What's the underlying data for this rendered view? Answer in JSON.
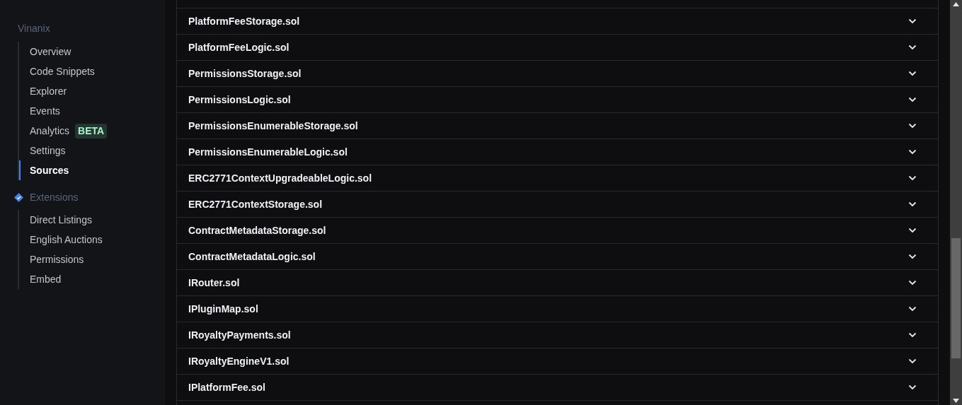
{
  "sidebar": {
    "title": "Vinanix",
    "items": [
      {
        "label": "Overview",
        "selected": false
      },
      {
        "label": "Code Snippets",
        "selected": false
      },
      {
        "label": "Explorer",
        "selected": false
      },
      {
        "label": "Events",
        "selected": false
      },
      {
        "label": "Analytics",
        "selected": false,
        "badge": "BETA"
      },
      {
        "label": "Settings",
        "selected": false
      },
      {
        "label": "Sources",
        "selected": true
      }
    ],
    "extensions": {
      "title": "Extensions",
      "items": [
        {
          "label": "Direct Listings",
          "selected": false
        },
        {
          "label": "English Auctions",
          "selected": false
        },
        {
          "label": "Permissions",
          "selected": false
        },
        {
          "label": "Embed",
          "selected": false
        }
      ]
    }
  },
  "sources": [
    {
      "name": "PlatformFeeStorage.sol",
      "expanded": false
    },
    {
      "name": "PlatformFeeLogic.sol",
      "expanded": false
    },
    {
      "name": "PermissionsStorage.sol",
      "expanded": false
    },
    {
      "name": "PermissionsLogic.sol",
      "expanded": false
    },
    {
      "name": "PermissionsEnumerableStorage.sol",
      "expanded": false
    },
    {
      "name": "PermissionsEnumerableLogic.sol",
      "expanded": false
    },
    {
      "name": "ERC2771ContextUpgradeableLogic.sol",
      "expanded": false
    },
    {
      "name": "ERC2771ContextStorage.sol",
      "expanded": false
    },
    {
      "name": "ContractMetadataStorage.sol",
      "expanded": false
    },
    {
      "name": "ContractMetadataLogic.sol",
      "expanded": false
    },
    {
      "name": "IRouter.sol",
      "expanded": false
    },
    {
      "name": "IPluginMap.sol",
      "expanded": false
    },
    {
      "name": "IRoyaltyPayments.sol",
      "expanded": false
    },
    {
      "name": "IRoyaltyEngineV1.sol",
      "expanded": false
    },
    {
      "name": "IPlatformFee.sol",
      "expanded": false
    }
  ]
}
